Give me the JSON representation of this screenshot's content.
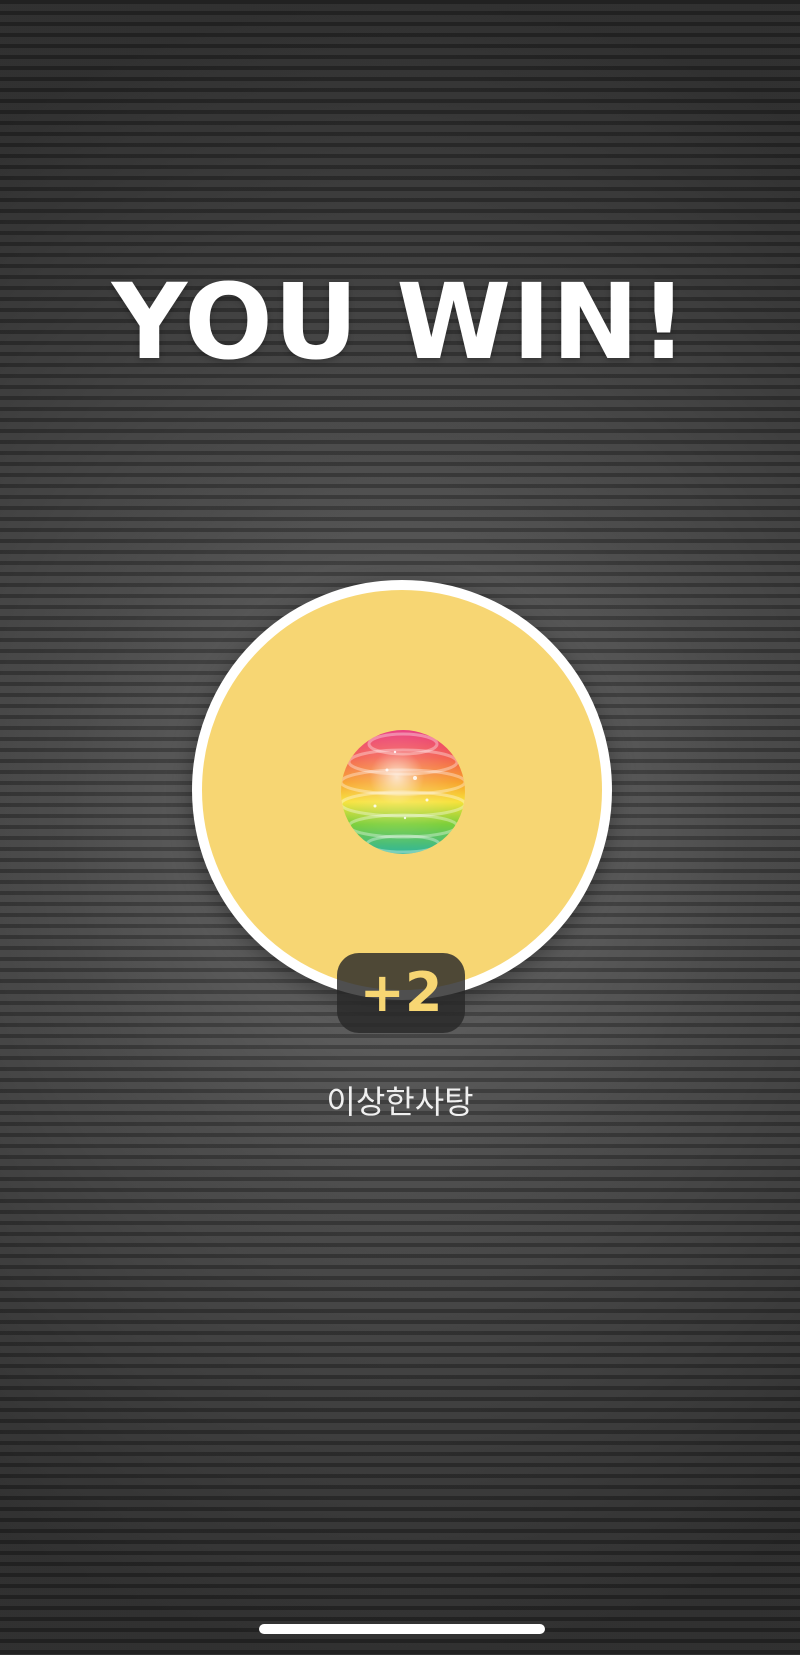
{
  "result": {
    "title": "YOU WIN!"
  },
  "reward": {
    "icon": "rainbow-candy-icon",
    "circle_color": "#f7d673",
    "amount": "+2",
    "amount_color": "#f7d673",
    "item_name": "이상한사탕"
  }
}
